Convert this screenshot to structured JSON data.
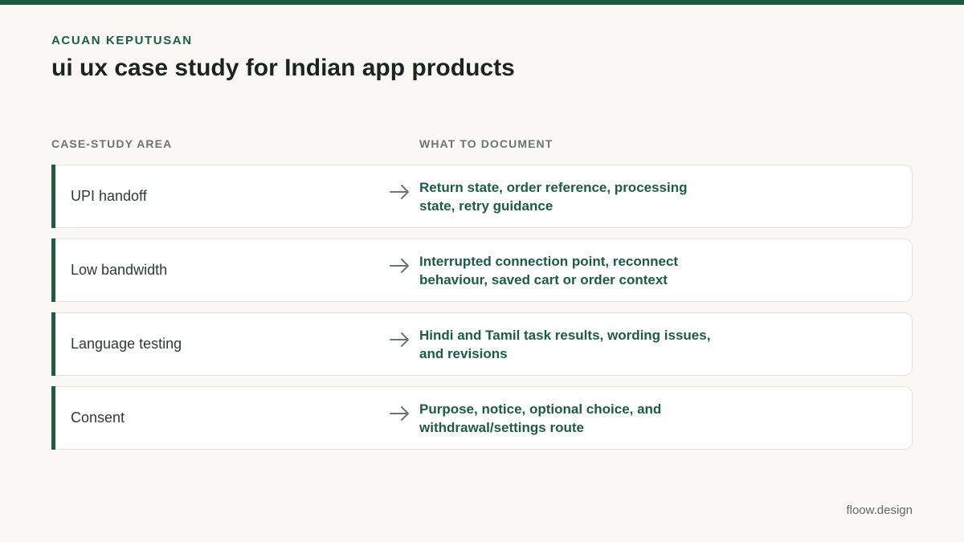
{
  "colors": {
    "accent": "#1d5b45",
    "background": "#f9f8f5",
    "title": "#1b2420",
    "muted": "#6b756f"
  },
  "header": {
    "eyebrow": "ACUAN KEPUTUSAN",
    "title": "ui ux case study for Indian app products"
  },
  "table": {
    "columns": {
      "area": "CASE-STUDY AREA",
      "document": "WHAT TO DOCUMENT"
    },
    "arrow_icon": "arrow-right-icon",
    "rows": [
      {
        "area": "UPI handoff",
        "document": "Return state, order reference, processing state, retry guidance"
      },
      {
        "area": "Low bandwidth",
        "document": "Interrupted connection point, reconnect behaviour, saved cart or order context"
      },
      {
        "area": "Language testing",
        "document": "Hindi and Tamil task results, wording issues, and revisions"
      },
      {
        "area": "Consent",
        "document": "Purpose, notice, optional choice, and withdrawal/settings route"
      }
    ]
  },
  "footer": {
    "brand": "floow.design"
  }
}
